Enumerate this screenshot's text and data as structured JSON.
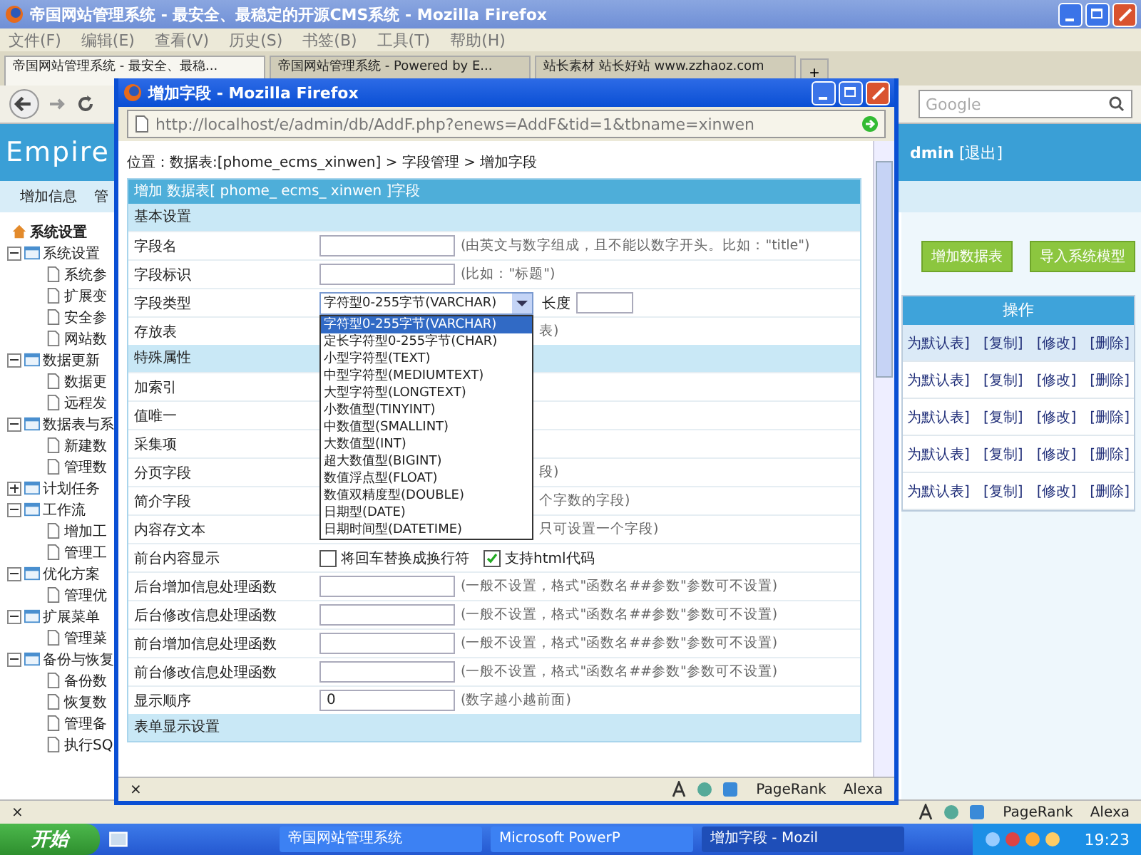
{
  "browser": {
    "title": "帝国网站管理系统 - 最安全、最稳定的开源CMS系统 - Mozilla Firefox",
    "menu": [
      "文件(F)",
      "编辑(E)",
      "查看(V)",
      "历史(S)",
      "书签(B)",
      "工具(T)",
      "帮助(H)"
    ],
    "tabs": [
      {
        "label": "帝国网站管理系统 - 最安全、最稳...",
        "selected": true
      },
      {
        "label": "帝国网站管理系统 - Powered by E...",
        "selected": false
      },
      {
        "label": "站长素材 站长好站 www.zzhaoz.com",
        "selected": false
      }
    ],
    "new_tab": "+",
    "search": {
      "placeholder": "Google"
    }
  },
  "page": {
    "logo": "Empire",
    "user": "dmin",
    "logout": "[退出]",
    "nav": [
      "增加信息",
      "管"
    ],
    "tree": {
      "root": "系统设置",
      "groups": [
        {
          "label": "系统设置",
          "expanded": true,
          "children": [
            "系统参",
            "扩展变",
            "安全参",
            "网站数"
          ]
        },
        {
          "label": "数据更新",
          "expanded": true,
          "children": [
            "数据更",
            "远程发"
          ]
        },
        {
          "label": "数据表与系",
          "expanded": true,
          "children": [
            "新建数",
            "管理数"
          ]
        },
        {
          "label": "计划任务",
          "expanded": false
        },
        {
          "label": "工作流",
          "expanded": true,
          "children": [
            "增加工",
            "管理工"
          ]
        },
        {
          "label": "优化方案",
          "expanded": true,
          "children": [
            "管理优"
          ]
        },
        {
          "label": "扩展菜单",
          "expanded": true,
          "children": [
            "管理菜"
          ]
        },
        {
          "label": "备份与恢复",
          "expanded": true,
          "children": [
            "备份数",
            "恢复数",
            "管理备",
            "执行SQ"
          ]
        }
      ]
    },
    "actions": [
      "增加数据表",
      "导入系统模型"
    ],
    "table": {
      "header": "操作",
      "rows": [
        [
          "为默认表]",
          "[复制]",
          "[修改]",
          "[删除]"
        ],
        [
          "为默认表]",
          "[复制]",
          "[修改]",
          "[删除]"
        ],
        [
          "为默认表]",
          "[复制]",
          "[修改]",
          "[删除]"
        ],
        [
          "为默认表]",
          "[复制]",
          "[修改]",
          "[删除]"
        ],
        [
          "为默认表]",
          "[复制]",
          "[修改]",
          "[删除]"
        ]
      ]
    }
  },
  "status_bar": {
    "close": "×",
    "items": [
      "PageRank",
      "Alexa"
    ]
  },
  "popup": {
    "title": "增加字段 - Mozilla Firefox",
    "url": "http://localhost/e/admin/db/AddF.php?enews=AddF&tid=1&tbname=xinwen",
    "breadcrumb": "位置：数据表:[phome_ecms_xinwen] > 字段管理 > 增加字段",
    "form_title": "增加 数据表[ phome_ ecms_ xinwen ]字段",
    "sections": [
      {
        "title": "基本设置",
        "rows": [
          {
            "kind": "input",
            "label": "字段名",
            "hint": "(由英文与数字组成，且不能以数字开头。比如：\"title\")"
          },
          {
            "kind": "input",
            "label": "字段标识",
            "hint": "(比如：\"标题\")"
          },
          {
            "kind": "select",
            "label": "字段类型",
            "value": "字符型0-255字节(VARCHAR)",
            "extra": "长度"
          },
          {
            "kind": "covered",
            "label": "存放表",
            "hint": "表)"
          }
        ]
      },
      {
        "title": "特殊属性",
        "rows": [
          {
            "kind": "covered",
            "label": "加索引"
          },
          {
            "kind": "covered",
            "label": "值唯一"
          },
          {
            "kind": "covered",
            "label": "采集项"
          },
          {
            "kind": "covered",
            "label": "分页字段",
            "hint": "段)"
          },
          {
            "kind": "covered",
            "label": "简介字段",
            "hint": "个字数的字段)"
          },
          {
            "kind": "covered",
            "label": "内容存文本",
            "hint": "只可设置一个字段)"
          },
          {
            "kind": "checks",
            "label": "前台内容显示",
            "checks": [
              {
                "label": "将回车替换成换行符",
                "checked": false
              },
              {
                "label": "支持html代码",
                "checked": true
              }
            ]
          },
          {
            "kind": "input",
            "label": "后台增加信息处理函数",
            "hint": "(一般不设置，格式\"函数名##参数\"参数可不设置)"
          },
          {
            "kind": "input",
            "label": "后台修改信息处理函数",
            "hint": "(一般不设置，格式\"函数名##参数\"参数可不设置)"
          },
          {
            "kind": "input",
            "label": "前台增加信息处理函数",
            "hint": "(一般不设置，格式\"函数名##参数\"参数可不设置)"
          },
          {
            "kind": "input",
            "label": "前台修改信息处理函数",
            "hint": "(一般不设置，格式\"函数名##参数\"参数可不设置)"
          },
          {
            "kind": "input",
            "label": "显示顺序",
            "value": "0",
            "hint": "(数字越小越前面)"
          }
        ]
      },
      {
        "title": "表单显示设置"
      }
    ],
    "dropdown": [
      {
        "label": "字符型0-255字节(VARCHAR)",
        "selected": true
      },
      {
        "label": "定长字符型0-255字节(CHAR)",
        "selected": false
      },
      {
        "label": "小型字符型(TEXT)",
        "selected": false
      },
      {
        "label": "中型字符型(MEDIUMTEXT)",
        "selected": false
      },
      {
        "label": "大型字符型(LONGTEXT)",
        "selected": false
      },
      {
        "label": "小数值型(TINYINT)",
        "selected": false
      },
      {
        "label": "中数值型(SMALLINT)",
        "selected": false
      },
      {
        "label": "大数值型(INT)",
        "selected": false
      },
      {
        "label": "超大数值型(BIGINT)",
        "selected": false
      },
      {
        "label": "数值浮点型(FLOAT)",
        "selected": false
      },
      {
        "label": "数值双精度型(DOUBLE)",
        "selected": false
      },
      {
        "label": "日期型(DATE)",
        "selected": false
      },
      {
        "label": "日期时间型(DATETIME)",
        "selected": false
      }
    ],
    "status_bar": {
      "close": "×",
      "items": [
        "PageRank",
        "Alexa"
      ]
    }
  },
  "taskbar": {
    "start": "开始",
    "tasks": [
      {
        "label": "帝国网站管理系统",
        "selected": false
      },
      {
        "label": "Microsoft PowerP",
        "selected": false
      },
      {
        "label": "增加字段 - Mozil",
        "selected": true
      }
    ],
    "clock": "19:23"
  }
}
